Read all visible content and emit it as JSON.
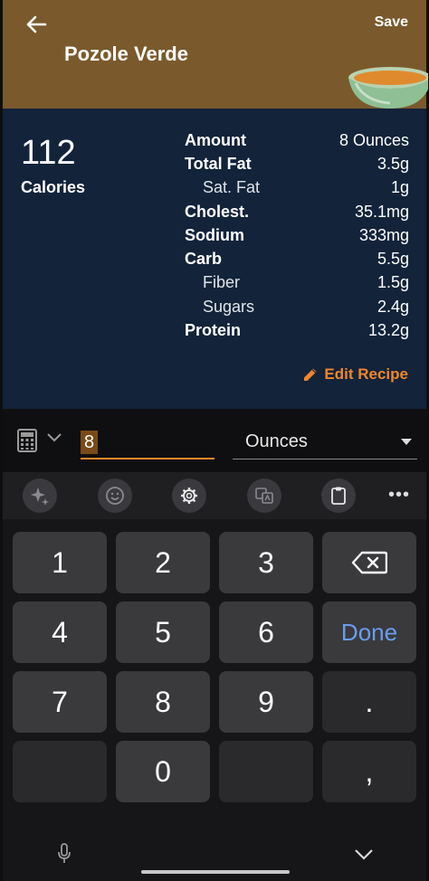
{
  "header": {
    "title": "Pozole Verde",
    "save_label": "Save"
  },
  "nutrition": {
    "calories_value": "112",
    "calories_label": "Calories",
    "rows": [
      {
        "label": "Amount",
        "value": "8 Ounces"
      },
      {
        "label": "Total Fat",
        "value": "3.5g"
      },
      {
        "label": "Sat. Fat",
        "value": "1g"
      },
      {
        "label": "Cholest.",
        "value": "35.1mg"
      },
      {
        "label": "Sodium",
        "value": "333mg"
      },
      {
        "label": "Carb",
        "value": "5.5g"
      },
      {
        "label": "Fiber",
        "value": "1.5g"
      },
      {
        "label": "Sugars",
        "value": "2.4g"
      },
      {
        "label": "Protein",
        "value": "13.2g"
      }
    ],
    "edit_label": "Edit Recipe"
  },
  "input": {
    "amount": "8",
    "unit": "Ounces"
  },
  "keyboard": {
    "keys": {
      "k1": "1",
      "k2": "2",
      "k3": "3",
      "k4": "4",
      "k5": "5",
      "k6": "6",
      "k7": "7",
      "k8": "8",
      "k9": "9",
      "k0": "0",
      "dot": ".",
      "comma": ",",
      "done": "Done"
    }
  },
  "colors": {
    "header_bg": "#7a5a2c",
    "panel_bg": "#12233a",
    "accent": "#f0862a",
    "done_blue": "#6a9cf0"
  }
}
